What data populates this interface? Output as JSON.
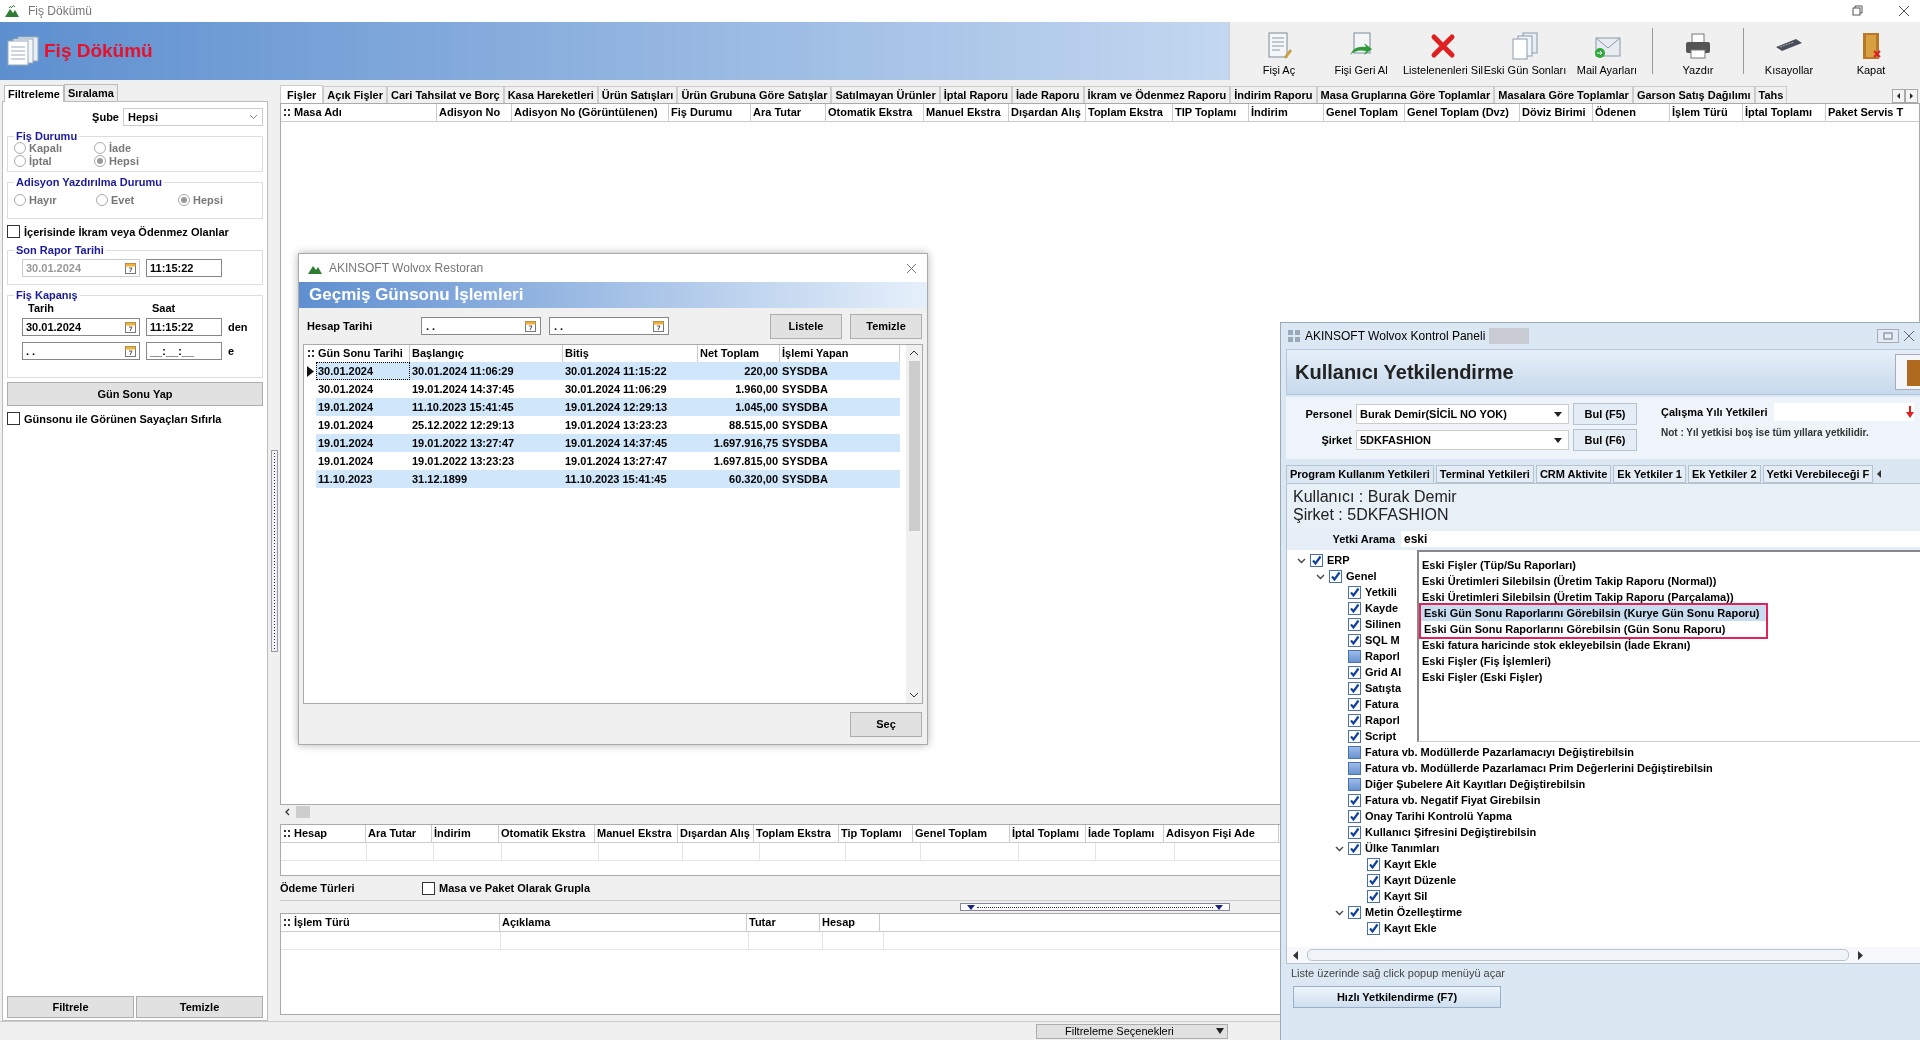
{
  "window": {
    "title": "Fiş Dökümü"
  },
  "header": {
    "title": "Fiş Dökümü"
  },
  "toolbar": [
    {
      "label": "Fişi Aç",
      "kind": "open",
      "separator_before": false
    },
    {
      "label": "Fişi Geri Al",
      "kind": "undo",
      "separator_before": false
    },
    {
      "label": "Listelenenleri Sil",
      "kind": "delete",
      "separator_before": false
    },
    {
      "label": "Eski Gün Sonları",
      "kind": "history",
      "separator_before": false
    },
    {
      "label": "Mail Ayarları",
      "kind": "mail",
      "separator_before": false
    },
    {
      "label": "Yazdır",
      "kind": "print",
      "separator_before": true
    },
    {
      "label": "Kısayollar",
      "kind": "keyboard",
      "separator_before": true
    },
    {
      "label": "Kapat",
      "kind": "exit",
      "separator_before": false
    }
  ],
  "filter_panel": {
    "tabs": [
      {
        "label": "Filtreleme",
        "selected": true
      },
      {
        "label": "Sıralama",
        "selected": false
      }
    ],
    "branch": {
      "label": "Şube",
      "value": "Hepsi"
    },
    "receipt_status": {
      "title": "Fiş Durumu",
      "options": [
        {
          "label": "Kapalı",
          "selected": false
        },
        {
          "label": "İade",
          "selected": false
        },
        {
          "label": "İptal",
          "selected": false
        },
        {
          "label": "Hepsi",
          "selected": true
        }
      ]
    },
    "print_status": {
      "title": "Adisyon Yazdırılma Durumu",
      "options": [
        {
          "label": "Hayır",
          "selected": false
        },
        {
          "label": "Evet",
          "selected": false
        },
        {
          "label": "Hepsi",
          "selected": true
        }
      ]
    },
    "treat_checkbox": {
      "label": "İçerisinde İkram veya Ödenmez Olanlar",
      "checked": false
    },
    "last_report": {
      "title": "Son Rapor Tarihi",
      "date": "30.01.2024",
      "time": "11:15:22"
    },
    "closing": {
      "title": "Fiş Kapanış",
      "date_label": "Tarih",
      "time_label": "Saat",
      "from_date": "30.01.2024",
      "from_time": "11:15:22",
      "from_suffix": "den",
      "to_date": ". .",
      "to_time": "__:__:__",
      "to_suffix": "e"
    },
    "end_of_day_button": "Gün Sonu Yap",
    "reset_checkbox": {
      "label": "Günsonu ile Görünen Sayaçları Sıfırla",
      "checked": false
    },
    "buttons": [
      "Filtrele",
      "Temizle"
    ]
  },
  "tabs": [
    {
      "label": "Fişler",
      "selected": true
    },
    {
      "label": "Açık Fişler",
      "selected": false
    },
    {
      "label": "Cari Tahsilat ve Borç",
      "selected": false
    },
    {
      "label": "Kasa Hareketleri",
      "selected": false
    },
    {
      "label": "Ürün Satışları",
      "selected": false
    },
    {
      "label": "Ürün Grubuna Göre Satışlar",
      "selected": false
    },
    {
      "label": "Satılmayan Ürünler",
      "selected": false
    },
    {
      "label": "İptal Raporu",
      "selected": false
    },
    {
      "label": "İade Raporu",
      "selected": false
    },
    {
      "label": "İkram ve Ödenmez Raporu",
      "selected": false
    },
    {
      "label": "İndirim Raporu",
      "selected": false
    },
    {
      "label": "Masa Gruplarına Göre Toplamlar",
      "selected": false
    },
    {
      "label": "Masalara Göre Toplamlar",
      "selected": false
    },
    {
      "label": "Garson Satış Dağılımı",
      "selected": false
    },
    {
      "label": "Tahs",
      "selected": false
    }
  ],
  "receipts_table": {
    "columns": [
      "Masa Adı",
      "Adisyon No",
      "Adisyon No (Görüntülenen)",
      "Fiş Durumu",
      "Ara Tutar",
      "Otomatik Ekstra",
      "Manuel Ekstra",
      "Dışardan Alış",
      "Toplam Ekstra",
      "TIP Toplamı",
      "İndirim",
      "Genel Toplam",
      "Genel Toplam (Dvz)",
      "Döviz Birimi",
      "Ödenen",
      "İşlem Türü",
      "İptal Toplamı",
      "Paket Servis T"
    ]
  },
  "totals_table": {
    "columns": [
      "Hesap",
      "Ara Tutar",
      "İndirim",
      "Otomatik Ekstra",
      "Manuel Ekstra",
      "Dışardan Alış",
      "Toplam Ekstra",
      "Tip Toplamı",
      "Genel Toplam",
      "İptal Toplamı",
      "İade Toplamı",
      "Adisyon Fişi Ade"
    ]
  },
  "payment_types": {
    "label": "Ödeme Türleri",
    "group_checkbox": {
      "label": "Masa ve Paket Olarak Grupla",
      "checked": false
    }
  },
  "transactions_table": {
    "columns": [
      "İşlem Türü",
      "Açıklama",
      "Tutar",
      "Hesap"
    ]
  },
  "status_bar": {
    "filter_options": "Filtreleme Seçenekleri"
  },
  "history_dialog": {
    "title": "AKINSOFT Wolvox Restoran",
    "header": "Geçmiş Günsonu İşlemleri",
    "date_label": "Hesap Tarihi",
    "from_date": ". .",
    "to_date": ". .",
    "buttons": [
      "Listele",
      "Temizle"
    ],
    "table": {
      "columns": [
        "Gün Sonu Tarihi",
        "Başlangıç",
        "Bitiş",
        "Net Toplam",
        "İşlemi Yapan"
      ],
      "rows": [
        {
          "cells": [
            "30.01.2024",
            "30.01.2024 11:06:29",
            "30.01.2024 11:15:22",
            "220,00",
            "SYSDBA"
          ],
          "selected": true
        },
        {
          "cells": [
            "30.01.2024",
            "19.01.2024 14:37:45",
            "30.01.2024 11:06:29",
            "1.960,00",
            "SYSDBA"
          ],
          "selected": false
        },
        {
          "cells": [
            "19.01.2024",
            "11.10.2023 15:41:45",
            "19.01.2024 12:29:13",
            "1.045,00",
            "SYSDBA"
          ],
          "selected": false
        },
        {
          "cells": [
            "19.01.2024",
            "25.12.2022 12:29:13",
            "19.01.2024 13:23:23",
            "88.515,00",
            "SYSDBA"
          ],
          "selected": false
        },
        {
          "cells": [
            "19.01.2024",
            "19.01.2022 13:27:47",
            "19.01.2024 14:37:45",
            "1.697.916,75",
            "SYSDBA"
          ],
          "selected": false
        },
        {
          "cells": [
            "19.01.2024",
            "19.01.2022 13:23:23",
            "19.01.2024 13:27:47",
            "1.697.815,00",
            "SYSDBA"
          ],
          "selected": false
        },
        {
          "cells": [
            "11.10.2023",
            "31.12.1899",
            "11.10.2023 15:41:45",
            "60.320,00",
            "SYSDBA"
          ],
          "selected": false
        }
      ]
    },
    "select_button": "Seç"
  },
  "permissions_dialog": {
    "title": "AKINSOFT Wolvox Kontrol Paneli",
    "header": "Kullanıcı Yetkilendirme",
    "personnel": {
      "label": "Personel",
      "value": "Burak Demir(SİCİL NO YOK)",
      "button": "Bul (F5)"
    },
    "company": {
      "label": "Şirket",
      "value": "5DKFASHION",
      "button": "Bul (F6)"
    },
    "year_permissions": {
      "label": "Çalışma Yılı Yetkileri"
    },
    "note": "Not : Yıl yetkisi boş ise tüm yıllara yetkilidir.",
    "tabs": [
      {
        "label": "Program Kullanım Yetkileri",
        "selected": true
      },
      {
        "label": "Terminal Yetkileri",
        "selected": false
      },
      {
        "label": "CRM Aktivite",
        "selected": false
      },
      {
        "label": "Ek Yetkiler 1",
        "selected": false
      },
      {
        "label": "Ek Yetkiler 2",
        "selected": false
      },
      {
        "label": "Yetki Verebileceği F",
        "selected": false
      }
    ],
    "user_line": "Kullanıcı : Burak Demir",
    "company_line": "Şirket : 5DKFASHION",
    "search": {
      "label": "Yetki Arama",
      "value": "eski"
    },
    "tree": [
      {
        "label": "ERP",
        "checked": true,
        "expanded": true,
        "children": [
          {
            "label": "Genel",
            "checked": true,
            "expanded": true,
            "children": [
              {
                "label": "Yetkili",
                "checked": true
              },
              {
                "label": "Kayde",
                "checked": true
              },
              {
                "label": "Silinen",
                "checked": true
              },
              {
                "label": "SQL M",
                "checked": true
              },
              {
                "label": "Raporl",
                "checked": false
              },
              {
                "label": "Grid Al",
                "checked": true
              },
              {
                "label": "Satışta",
                "checked": true
              },
              {
                "label": "Fatura",
                "checked": true
              },
              {
                "label": "Raporl",
                "checked": true
              },
              {
                "label": "Script",
                "checked": true
              },
              {
                "label": "Fatura vb. Modüllerde Pazarlamacıyı Değiştirebilsin",
                "checked": false
              },
              {
                "label": "Fatura vb. Modüllerde Pazarlamacı Prim Değerlerini Değiştirebilsin",
                "checked": false
              },
              {
                "label": "Diğer Şubelere Ait Kayıtları Değiştirebilsin",
                "checked": false
              },
              {
                "label": "Fatura vb. Negatif Fiyat Girebilsin",
                "checked": true
              },
              {
                "label": "Onay Tarihi Kontrolü Yapma",
                "checked": true
              },
              {
                "label": "Kullanıcı Şifresini Değiştirebilsin",
                "checked": true
              },
              {
                "label": "Ülke Tanımları",
                "checked": true,
                "expanded": true,
                "children": [
                  {
                    "label": "Kayıt Ekle",
                    "checked": true
                  },
                  {
                    "label": "Kayıt Düzenle",
                    "checked": true
                  },
                  {
                    "label": "Kayıt Sil",
                    "checked": true
                  }
                ]
              },
              {
                "label": "Metin Özelleştirme",
                "checked": true,
                "expanded": true,
                "children": [
                  {
                    "label": "Kayıt Ekle",
                    "checked": true
                  }
                ]
              }
            ]
          }
        ]
      }
    ],
    "suggestions": [
      {
        "text": "Eski Fişler (Tüp/Su Raporları)",
        "selected": false,
        "highlighted": false
      },
      {
        "text": "Eski Üretimleri Silebilsin (Üretim Takip Raporu (Normal))",
        "selected": false,
        "highlighted": false
      },
      {
        "text": "Eski Üretimleri Silebilsin (Üretim Takip Raporu (Parçalama))",
        "selected": false,
        "highlighted": false
      },
      {
        "text": "Eski Gün Sonu Raporlarını Görebilsin (Kurye Gün Sonu Raporu)",
        "selected": true,
        "highlighted": true
      },
      {
        "text": "Eski Gün Sonu Raporlarını Görebilsin (Gün Sonu Raporu)",
        "selected": false,
        "highlighted": true
      },
      {
        "text": "Eski fatura haricinde stok ekleyebilsin (İade Ekranı)",
        "selected": false,
        "highlighted": false
      },
      {
        "text": "Eski Fişler (Fiş İşlemleri)",
        "selected": false,
        "highlighted": false
      },
      {
        "text": "Eski Fişler (Eski Fişler)",
        "selected": false,
        "highlighted": false
      }
    ],
    "hint": "Liste üzerinde sağ click popup menüyü açar",
    "quick_button": "Hızlı Yetkilendirme (F7)"
  }
}
